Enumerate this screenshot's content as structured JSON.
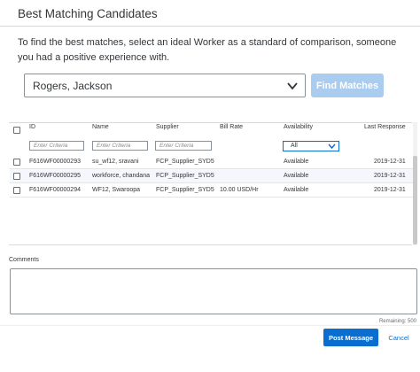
{
  "dialog": {
    "title": "Best Matching Candidates",
    "instructions": "To find the best matches, select an ideal Worker as a standard of comparison, someone you had a positive experience with."
  },
  "worker_select": {
    "value": "Rogers, Jackson",
    "icon": "chevron-down-icon"
  },
  "find_button": {
    "label": "Find Matches"
  },
  "table": {
    "columns": {
      "id": "ID",
      "name": "Name",
      "supplier": "Supplier",
      "bill_rate": "Bill Rate",
      "availability": "Availability",
      "last_response": "Last Response"
    },
    "filter_placeholder": "Enter Criteria",
    "availability_filter": "All",
    "rows": [
      {
        "id": "F616WF00000293",
        "name": "su_wf12, sravani",
        "supplier": "FCP_Supplier_SYD5",
        "bill_rate": "",
        "availability": "Available",
        "last_response": "2019-12-31"
      },
      {
        "id": "F616WF00000295",
        "name": "workforce, chandana",
        "supplier": "FCP_Supplier_SYD5",
        "bill_rate": "",
        "availability": "Available",
        "last_response": "2019-12-31"
      },
      {
        "id": "F616WF00000294",
        "name": "WF12, Swaroopa",
        "supplier": "FCP_Supplier_SYD5",
        "bill_rate": "10.00 USD/Hr",
        "availability": "Available",
        "last_response": "2019-12-31"
      }
    ]
  },
  "comments": {
    "label": "Comments",
    "remaining": "Remaining: 500"
  },
  "footer": {
    "post_label": "Post Message",
    "cancel_label": "Cancel"
  },
  "colors": {
    "accent": "#0a6ed1",
    "disabled_button": "#a9ccef",
    "selected_row": "#f4f8fc"
  }
}
